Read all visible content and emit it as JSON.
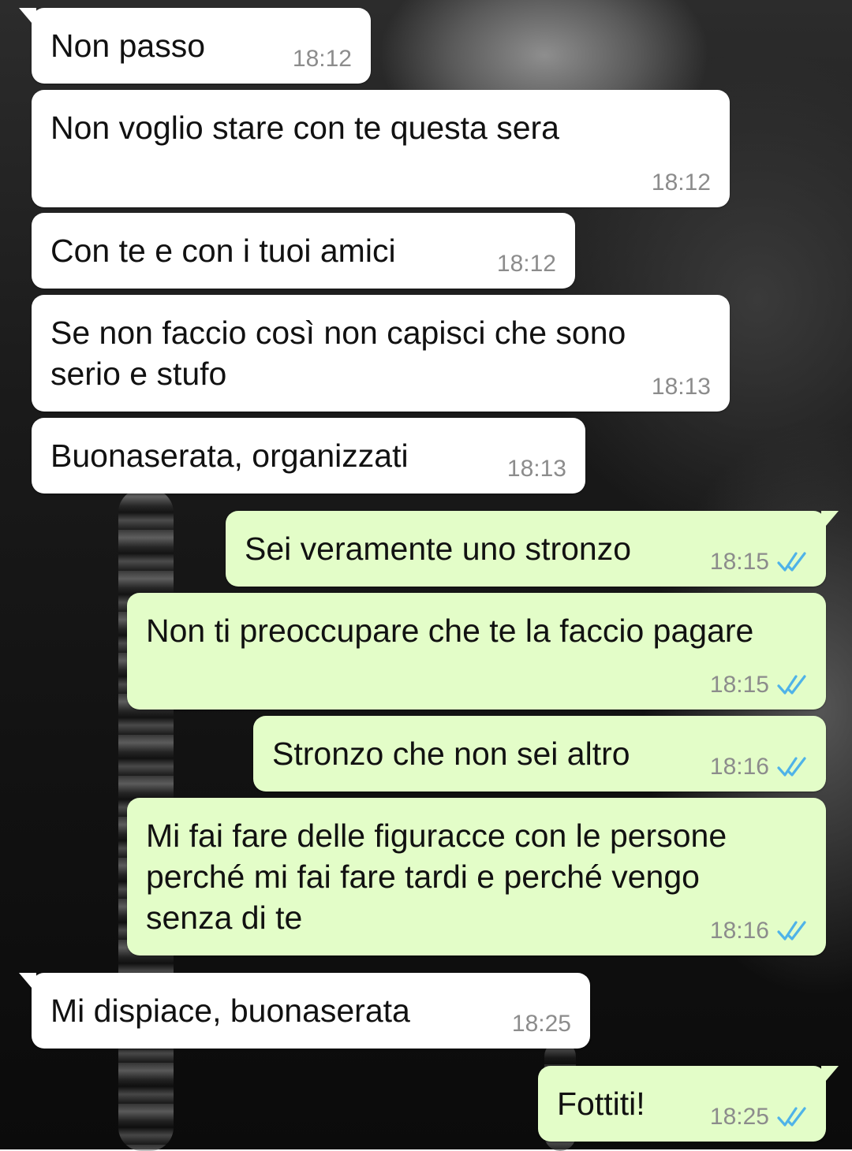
{
  "chat": {
    "messages": [
      {
        "direction": "incoming",
        "text": "Non passo",
        "time": "18:12"
      },
      {
        "direction": "incoming",
        "text": "Non voglio stare con te questa sera",
        "time": "18:12"
      },
      {
        "direction": "incoming",
        "text": "Con te e con i tuoi amici",
        "time": "18:12"
      },
      {
        "direction": "incoming",
        "text": "Se non faccio così non capisci che sono\nserio e stufo",
        "time": "18:13"
      },
      {
        "direction": "incoming",
        "text": "Buonaserata, organizzati",
        "time": "18:13"
      },
      {
        "direction": "outgoing",
        "text": "Sei veramente uno stronzo",
        "time": "18:15",
        "status": "read"
      },
      {
        "direction": "outgoing",
        "text": "Non ti preoccupare che te la faccio pagare",
        "time": "18:15",
        "status": "read"
      },
      {
        "direction": "outgoing",
        "text": "Stronzo che non sei altro",
        "time": "18:16",
        "status": "read"
      },
      {
        "direction": "outgoing",
        "text": "Mi fai fare delle figuracce con le persone\nperché mi fai fare tardi e perché vengo\nsenza di te",
        "time": "18:16",
        "status": "read"
      },
      {
        "direction": "incoming",
        "text": "Mi dispiace, buonaserata",
        "time": "18:25"
      },
      {
        "direction": "outgoing",
        "text": "Fottiti!",
        "time": "18:25",
        "status": "read"
      }
    ]
  },
  "colors": {
    "incoming_bubble": "#ffffff",
    "outgoing_bubble": "#e3fdc8",
    "timestamp": "#8c8c8c",
    "read_ticks": "#4fb3e8"
  },
  "icons": {
    "read_status": "double-check-icon"
  }
}
